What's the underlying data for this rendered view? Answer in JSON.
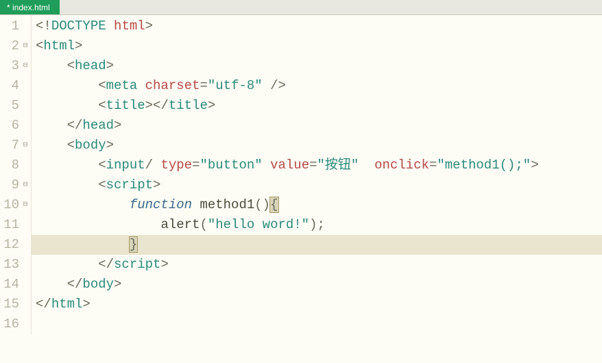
{
  "tab": {
    "title": "* index.html"
  },
  "lines": [
    {
      "num": "1",
      "fold": "",
      "hl": false,
      "tokens": [
        [
          "punc",
          "<!"
        ],
        [
          "tag",
          "DOCTYPE"
        ],
        [
          "text",
          " "
        ],
        [
          "attr",
          "html"
        ],
        [
          "punc",
          ">"
        ]
      ]
    },
    {
      "num": "2",
      "fold": "⊟",
      "hl": false,
      "tokens": [
        [
          "punc",
          "<"
        ],
        [
          "tag",
          "html"
        ],
        [
          "punc",
          ">"
        ]
      ]
    },
    {
      "num": "3",
      "fold": "⊟",
      "hl": false,
      "tokens": [
        [
          "text",
          "    "
        ],
        [
          "punc",
          "<"
        ],
        [
          "tag",
          "head"
        ],
        [
          "punc",
          ">"
        ]
      ]
    },
    {
      "num": "4",
      "fold": "",
      "hl": false,
      "tokens": [
        [
          "text",
          "        "
        ],
        [
          "punc",
          "<"
        ],
        [
          "tag",
          "meta"
        ],
        [
          "text",
          " "
        ],
        [
          "attr",
          "charset"
        ],
        [
          "punc",
          "="
        ],
        [
          "str",
          "\"utf-8\""
        ],
        [
          "text",
          " "
        ],
        [
          "punc",
          "/>"
        ]
      ]
    },
    {
      "num": "5",
      "fold": "",
      "hl": false,
      "tokens": [
        [
          "text",
          "        "
        ],
        [
          "punc",
          "<"
        ],
        [
          "tag",
          "title"
        ],
        [
          "punc",
          "></"
        ],
        [
          "tag",
          "title"
        ],
        [
          "punc",
          ">"
        ]
      ]
    },
    {
      "num": "6",
      "fold": "",
      "hl": false,
      "tokens": [
        [
          "text",
          "    "
        ],
        [
          "punc",
          "</"
        ],
        [
          "tag",
          "head"
        ],
        [
          "punc",
          ">"
        ]
      ]
    },
    {
      "num": "7",
      "fold": "⊟",
      "hl": false,
      "tokens": [
        [
          "text",
          "    "
        ],
        [
          "punc",
          "<"
        ],
        [
          "tag",
          "body"
        ],
        [
          "punc",
          ">"
        ]
      ]
    },
    {
      "num": "8",
      "fold": "",
      "hl": false,
      "tokens": [
        [
          "text",
          "        "
        ],
        [
          "punc",
          "<"
        ],
        [
          "tag",
          "input"
        ],
        [
          "punc",
          "/"
        ],
        [
          "text",
          " "
        ],
        [
          "attr",
          "type"
        ],
        [
          "punc",
          "="
        ],
        [
          "str",
          "\"button\""
        ],
        [
          "text",
          " "
        ],
        [
          "attr",
          "value"
        ],
        [
          "punc",
          "="
        ],
        [
          "str",
          "\"按钮\""
        ],
        [
          "text",
          "  "
        ],
        [
          "attr",
          "onclick"
        ],
        [
          "punc",
          "="
        ],
        [
          "str",
          "\"method1();\""
        ],
        [
          "punc",
          ">"
        ]
      ]
    },
    {
      "num": "9",
      "fold": "⊟",
      "hl": false,
      "tokens": [
        [
          "text",
          "        "
        ],
        [
          "punc",
          "<"
        ],
        [
          "tag",
          "script"
        ],
        [
          "punc",
          ">"
        ]
      ]
    },
    {
      "num": "10",
      "fold": "⊟",
      "hl": false,
      "tokens": [
        [
          "text",
          "            "
        ],
        [
          "kw",
          "function"
        ],
        [
          "text",
          " "
        ],
        [
          "fn",
          "method1"
        ],
        [
          "punc",
          "()"
        ],
        [
          "brace",
          "{"
        ]
      ]
    },
    {
      "num": "11",
      "fold": "",
      "hl": false,
      "tokens": [
        [
          "text",
          "                "
        ],
        [
          "fn",
          "alert"
        ],
        [
          "punc",
          "("
        ],
        [
          "str",
          "\"hello word!\""
        ],
        [
          "punc",
          ");"
        ]
      ]
    },
    {
      "num": "12",
      "fold": "",
      "hl": true,
      "tokens": [
        [
          "text",
          "            "
        ],
        [
          "brace",
          "}"
        ]
      ]
    },
    {
      "num": "13",
      "fold": "",
      "hl": false,
      "tokens": [
        [
          "text",
          "        "
        ],
        [
          "punc",
          "</"
        ],
        [
          "tag",
          "script"
        ],
        [
          "punc",
          ">"
        ]
      ]
    },
    {
      "num": "14",
      "fold": "",
      "hl": false,
      "tokens": [
        [
          "text",
          "    "
        ],
        [
          "punc",
          "</"
        ],
        [
          "tag",
          "body"
        ],
        [
          "punc",
          ">"
        ]
      ]
    },
    {
      "num": "15",
      "fold": "",
      "hl": false,
      "tokens": [
        [
          "punc",
          "</"
        ],
        [
          "tag",
          "html"
        ],
        [
          "punc",
          ">"
        ]
      ]
    },
    {
      "num": "16",
      "fold": "",
      "hl": false,
      "tokens": []
    }
  ]
}
